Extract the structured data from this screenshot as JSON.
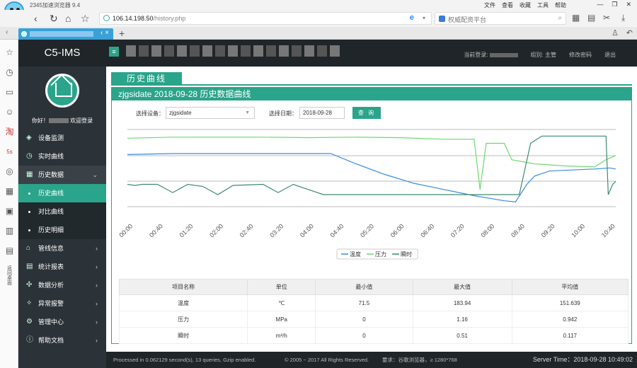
{
  "browser": {
    "title": "2345加速浏览器 9.4",
    "menus": [
      "文件",
      "查看",
      "收藏",
      "工具",
      "帮助"
    ],
    "url_host": "106.14.198.50",
    "url_path": "/history.php",
    "search_placeholder": "权威配资平台"
  },
  "app": {
    "brand": "C5-IMS",
    "menu_icon": "≡",
    "current_user_label": "当前登录:",
    "group_label": "组别: 主管",
    "change_password": "修改密码",
    "logout": "退出",
    "welcome_prefix": "你好！",
    "welcome_suffix": "欢迎登录"
  },
  "sidebar": {
    "items": [
      {
        "label": "设备监测",
        "icon": "layers-icon"
      },
      {
        "label": "实时曲线",
        "icon": "clock-icon"
      },
      {
        "label": "历史数据",
        "icon": "calendar-icon"
      },
      {
        "label": "历史曲线"
      },
      {
        "label": "对比曲线"
      },
      {
        "label": "历史明细"
      },
      {
        "label": "管线信息",
        "icon": "bank-icon"
      },
      {
        "label": "统计报表",
        "icon": "report-icon"
      },
      {
        "label": "数据分析",
        "icon": "puzzle-icon"
      },
      {
        "label": "异常报警",
        "icon": "alarm-icon"
      },
      {
        "label": "管理中心",
        "icon": "gear-icon"
      },
      {
        "label": "帮助文档",
        "icon": "info-icon"
      }
    ]
  },
  "page": {
    "tab_title": "历史曲线",
    "panel_title": "zjgsidate 2018-09-28 历史数据曲线",
    "device_label": "选择设备：",
    "device_value": "zjgsidate",
    "date_label": "选择日期：",
    "date_value": "2018-09-28",
    "query_button": "查 询"
  },
  "chart_data": {
    "type": "line",
    "x_ticks": [
      "00:00",
      "00:40",
      "01:20",
      "02:00",
      "02:40",
      "03:20",
      "04:00",
      "04:40",
      "05:20",
      "06:00",
      "06:40",
      "07:20",
      "08:00",
      "08:40",
      "09:20",
      "10:00",
      "10:40"
    ],
    "xlim": [
      "00:00",
      "10:48"
    ],
    "grid": "horizontal",
    "legend_position": "bottom",
    "series": [
      {
        "name": "温度",
        "color": "#3b8be0",
        "points": [
          [
            "00:00",
            178
          ],
          [
            "01:00",
            180
          ],
          [
            "02:00",
            180
          ],
          [
            "03:00",
            180
          ],
          [
            "04:00",
            180
          ],
          [
            "04:30",
            180
          ],
          [
            "05:00",
            162
          ],
          [
            "05:40",
            140
          ],
          [
            "06:20",
            122
          ],
          [
            "07:00",
            110
          ],
          [
            "07:40",
            98
          ],
          [
            "08:20",
            88
          ],
          [
            "08:35",
            86
          ],
          [
            "08:50",
            120
          ],
          [
            "09:00",
            136
          ],
          [
            "09:20",
            146
          ],
          [
            "09:50",
            148
          ],
          [
            "10:20",
            150
          ],
          [
            "10:40",
            152
          ],
          [
            "10:48",
            150
          ]
        ]
      },
      {
        "name": "压力",
        "color": "#6fd86f",
        "points": [
          [
            "00:00",
            210
          ],
          [
            "01:00",
            212
          ],
          [
            "02:00",
            212
          ],
          [
            "03:00",
            212
          ],
          [
            "04:00",
            211
          ],
          [
            "05:00",
            212
          ],
          [
            "06:00",
            211
          ],
          [
            "07:00",
            208
          ],
          [
            "07:40",
            208
          ],
          [
            "07:48",
            110
          ],
          [
            "07:56",
            200
          ],
          [
            "08:20",
            200
          ],
          [
            "08:30",
            168
          ],
          [
            "09:00",
            160
          ],
          [
            "09:40",
            156
          ],
          [
            "10:20",
            154
          ],
          [
            "10:35",
            168
          ],
          [
            "10:48",
            176
          ]
        ]
      },
      {
        "name": "瞬时",
        "color": "#3d8a6e",
        "points": [
          [
            "00:00",
            120
          ],
          [
            "00:10",
            118
          ],
          [
            "00:20",
            120
          ],
          [
            "00:40",
            120
          ],
          [
            "01:00",
            104
          ],
          [
            "01:20",
            120
          ],
          [
            "01:40",
            116
          ],
          [
            "02:00",
            100
          ],
          [
            "02:20",
            118
          ],
          [
            "03:00",
            120
          ],
          [
            "03:20",
            104
          ],
          [
            "03:40",
            120
          ],
          [
            "04:00",
            110
          ],
          [
            "04:20",
            100
          ],
          [
            "04:40",
            100
          ],
          [
            "05:40",
            100
          ],
          [
            "06:40",
            100
          ],
          [
            "07:40",
            100
          ],
          [
            "08:40",
            100
          ],
          [
            "08:55",
            200
          ],
          [
            "09:10",
            214
          ],
          [
            "09:40",
            214
          ],
          [
            "10:20",
            214
          ],
          [
            "10:35",
            214
          ],
          [
            "10:38",
            100
          ],
          [
            "10:44",
            120
          ],
          [
            "10:48",
            126
          ]
        ]
      }
    ]
  },
  "stats_table": {
    "headers": [
      "项目名称",
      "单位",
      "最小值",
      "最大值",
      "平均值"
    ],
    "rows": [
      [
        "温度",
        "℃",
        "71.5",
        "183.94",
        "151.639"
      ],
      [
        "压力",
        "MPa",
        "0",
        "1.16",
        "0.942"
      ],
      [
        "瞬时",
        "m³/h",
        "0",
        "0.51",
        "0.117"
      ]
    ]
  },
  "footer": {
    "processed": "Processed in 0.062129 second(s), 13 queries, Gzip enabled.",
    "copyright": "© 2005 ~ 2017 All Rights Reserved.",
    "requirement": "要求：谷歌浏览器，≥ 1280*768",
    "server_time": "Server Time：2018-09-28 10:49:02"
  }
}
